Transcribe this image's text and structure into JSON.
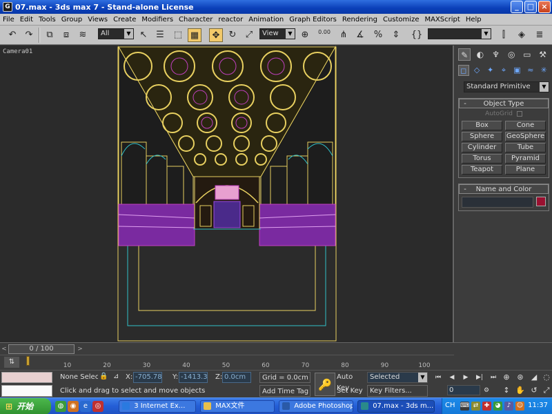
{
  "window": {
    "title": "07.max - 3ds max 7  - Stand-alone License",
    "icon_label": "G",
    "minimize_icon": "_",
    "maximize_icon": "□",
    "close_icon": "×"
  },
  "menu": [
    "File",
    "Edit",
    "Tools",
    "Group",
    "Views",
    "Create",
    "Modifiers",
    "Character",
    "reactor",
    "Animation",
    "Graph Editors",
    "Rendering",
    "Customize",
    "MAXScript",
    "Help"
  ],
  "toolbar": {
    "selection_filter": "All",
    "reference_coord": "View",
    "snap_value": "0.00",
    "named_selection": ""
  },
  "viewport": {
    "label": "Camera01"
  },
  "command_panel": {
    "category_dropdown": "Standard Primitive",
    "object_type": {
      "title": "Object Type",
      "autogrid": "AutoGrid",
      "buttons": [
        "Box",
        "Cone",
        "Sphere",
        "GeoSphere",
        "Cylinder",
        "Tube",
        "Torus",
        "Pyramid",
        "Teapot",
        "Plane"
      ]
    },
    "name_color": {
      "title": "Name and Color",
      "name_value": "",
      "color": "#9a1030"
    },
    "minus_icon": "-"
  },
  "time_slider": {
    "position": "0 / 100",
    "prev_icon": "<",
    "next_icon": ">"
  },
  "track_bar": {
    "ticks": [
      10,
      20,
      30,
      40,
      50,
      60,
      70,
      80,
      90,
      100
    ],
    "key_icon": "⇅"
  },
  "status": {
    "selection": "None Selected",
    "prompt": "Click and drag to select and move objects",
    "x_label": "X:",
    "x_value": "-705.783",
    "y_label": "Y:",
    "y_value": "-1413.30",
    "z_label": "Z:",
    "z_value": "0.0cm",
    "grid": "Grid = 0.0cm",
    "add_time_tag": "Add Time Tag",
    "auto_key": "Auto Key",
    "set_key": "Set Key",
    "key_mode": "Selected",
    "key_filters": "Key Filters...",
    "frame": "0",
    "key_icon": "🔑"
  },
  "taskbar": {
    "start": "开始",
    "start_flag": "⊞",
    "tasks": [
      {
        "label": "3 Internet Ex...",
        "color": "#2a7ae0"
      },
      {
        "label": "MAX文件",
        "color": "#e8c04a"
      },
      {
        "label": "Adobe Photoshop",
        "color": "#2a5aa8"
      },
      {
        "label": "07.max - 3ds m...",
        "color": "#2a8a8a"
      }
    ],
    "lang": "CH",
    "clock": "11:37"
  },
  "colors": {
    "scene_yellow": "#e8d060",
    "scene_magenta": "#c040c0",
    "scene_cyan": "#30c0c8",
    "scene_purple": "#9a4ae0",
    "viewport_bg": "#2b2b2b"
  }
}
